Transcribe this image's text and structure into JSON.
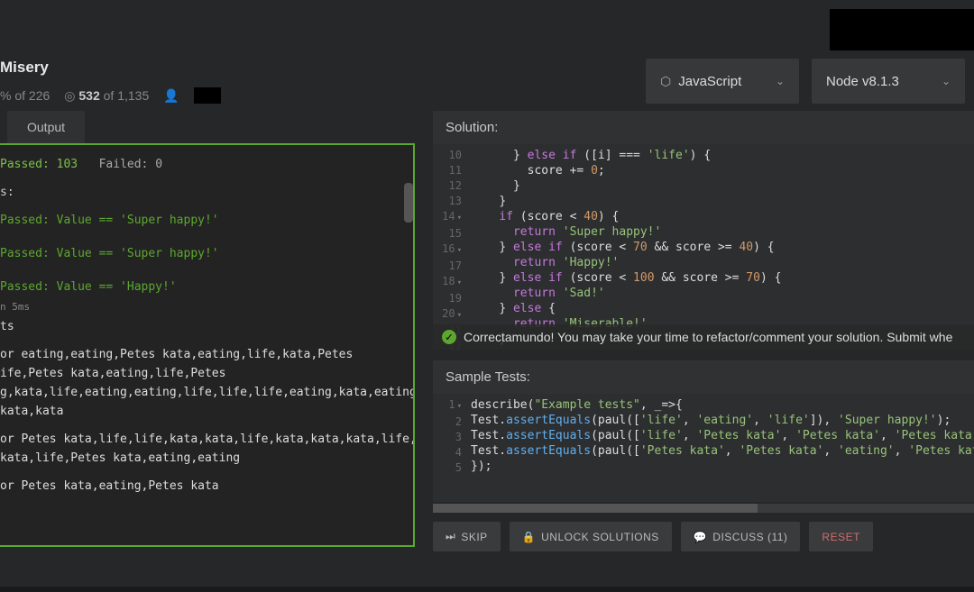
{
  "header": {
    "title": "Misery",
    "stats_left_pct": "% of 226",
    "stats_left_num": "226",
    "stats_mid_num": "532",
    "stats_mid_of": "of 1,135"
  },
  "dropdowns": {
    "language": "JavaScript",
    "runtime": "Node v8.1.3"
  },
  "tabs": {
    "output": "Output"
  },
  "output": {
    "passed_label": "Passed:",
    "passed_count": "103",
    "failed_label": "Failed:",
    "failed_count": "0",
    "header_s": "s:",
    "t1": "Passed: Value == 'Super happy!'",
    "t2": "Passed: Value == 'Super happy!'",
    "t3": "Passed: Value == 'Happy!'",
    "time": "n 5ms",
    "ts": "ts",
    "log1a": "or eating,eating,Petes kata,eating,life,kata,Petes",
    "log1b": "ife,Petes kata,eating,life,Petes",
    "log1c": "g,kata,life,eating,eating,life,life,life,eating,kata,eating,eating,Petes",
    "log1d": "kata,kata",
    "log2a": "or Petes kata,life,life,kata,kata,life,kata,kata,kata,life,Petes",
    "log2b": "kata,life,Petes kata,eating,eating",
    "log3a": "or Petes kata,eating,Petes kata"
  },
  "solution": {
    "label": "Solution:",
    "lines": {
      "10": {
        "indent": "      ",
        "a": "} ",
        "kw1": "else if",
        "b": " ([i] === ",
        "str": "'life'",
        "c": ") {"
      },
      "11": {
        "indent": "        ",
        "a": "score += ",
        "num": "0",
        "b": ";"
      },
      "12": {
        "indent": "      ",
        "a": "}"
      },
      "13": {
        "indent": "    ",
        "a": "}"
      },
      "14": {
        "indent": "    ",
        "kw": "if",
        "a": " (score < ",
        "num": "40",
        "b": ") {"
      },
      "15": {
        "indent": "      ",
        "kw": "return",
        "a": " ",
        "str": "'Super happy!'"
      },
      "16": {
        "indent": "    ",
        "a": "} ",
        "kw": "else if",
        "b": " (score < ",
        "num1": "70",
        "c": " && score >= ",
        "num2": "40",
        "d": ") {"
      },
      "17": {
        "indent": "      ",
        "kw": "return",
        "a": " ",
        "str": "'Happy!'"
      },
      "18": {
        "indent": "    ",
        "a": "} ",
        "kw": "else if",
        "b": " (score < ",
        "num1": "100",
        "c": " && score >= ",
        "num2": "70",
        "d": ") {"
      },
      "19": {
        "indent": "      ",
        "kw": "return",
        "a": " ",
        "str": "'Sad!'"
      },
      "20": {
        "indent": "    ",
        "a": "} ",
        "kw": "else",
        "b": " {"
      },
      "21": {
        "indent": "      ",
        "kw": "return",
        "a": " ",
        "str": "'Miserable!'"
      },
      "22": {
        "indent": "    ",
        "a": "}"
      }
    },
    "toast": "Correctamundo! You may take your time to refactor/comment your solution. Submit whe"
  },
  "tests": {
    "label": "Sample Tests:",
    "l1": {
      "a": "describe(",
      "str": "\"Example tests\"",
      "b": ", _=>{"
    },
    "l2": {
      "a": "Test.",
      "fn": "assertEquals",
      "b": "(paul([",
      "s1": "'life'",
      "c": ", ",
      "s2": "'eating'",
      "d": ", ",
      "s3": "'life'",
      "e": "]), ",
      "s4": "'Super happy!'",
      "f": ");"
    },
    "l3": {
      "a": "Test.",
      "fn": "assertEquals",
      "b": "(paul([",
      "s1": "'life'",
      "c": ", ",
      "s2": "'Petes kata'",
      "d": ", ",
      "s3": "'Petes kata'",
      "e": ", ",
      "s4": "'Petes kata'",
      "f": ","
    },
    "l4": {
      "a": "Test.",
      "fn": "assertEquals",
      "b": "(paul([",
      "s1": "'Petes kata'",
      "c": ", ",
      "s2": "'Petes kata'",
      "d": ", ",
      "s3": "'eating'",
      "e": ", ",
      "s4": "'Petes kata"
    },
    "l5": {
      "a": "});"
    }
  },
  "buttons": {
    "skip": "SKIP",
    "unlock": "UNLOCK SOLUTIONS",
    "discuss": "DISCUSS (11)",
    "reset": "RESET"
  }
}
